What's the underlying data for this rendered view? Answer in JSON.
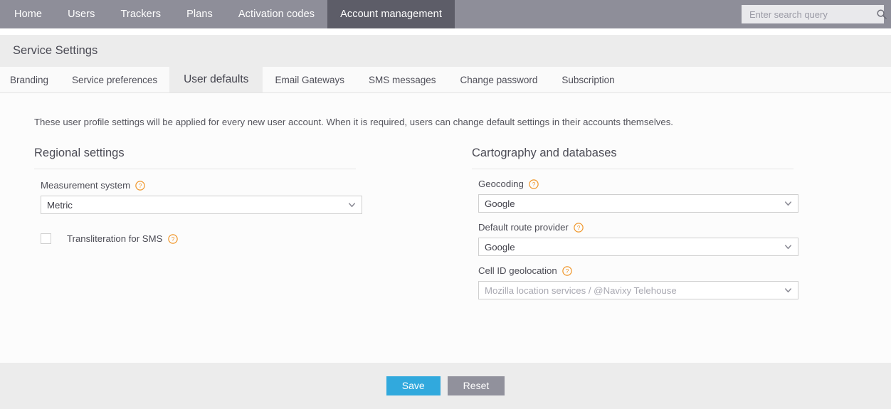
{
  "topnav": {
    "items": [
      {
        "label": "Home",
        "active": false
      },
      {
        "label": "Users",
        "active": false
      },
      {
        "label": "Trackers",
        "active": false
      },
      {
        "label": "Plans",
        "active": false
      },
      {
        "label": "Activation codes",
        "active": false
      },
      {
        "label": "Account management",
        "active": true
      }
    ],
    "search": {
      "placeholder": "Enter search query",
      "value": "",
      "icon": "search-icon"
    }
  },
  "header": {
    "title": "Service Settings"
  },
  "tabs": [
    {
      "label": "Branding",
      "active": false
    },
    {
      "label": "Service preferences",
      "active": false
    },
    {
      "label": "User defaults",
      "active": true
    },
    {
      "label": "Email Gateways",
      "active": false
    },
    {
      "label": "SMS messages",
      "active": false
    },
    {
      "label": "Change password",
      "active": false
    },
    {
      "label": "Subscription",
      "active": false
    }
  ],
  "main": {
    "intro": "These user profile settings will be applied for every new user account. When it is required, users can change default settings in their accounts themselves.",
    "regional": {
      "heading": "Regional settings",
      "measurement_system": {
        "label": "Measurement system",
        "value": "Metric",
        "help_icon": "help-icon",
        "chevron": "chevron-down-icon"
      },
      "transliteration": {
        "label": "Transliteration for SMS",
        "checked": false,
        "help_icon": "help-icon"
      }
    },
    "cartography": {
      "heading": "Cartography and databases",
      "geocoding": {
        "label": "Geocoding",
        "value": "Google",
        "help_icon": "help-icon",
        "chevron": "chevron-down-icon"
      },
      "route_provider": {
        "label": "Default route provider",
        "value": "Google",
        "help_icon": "help-icon",
        "chevron": "chevron-down-icon"
      },
      "cell_id_geolocation": {
        "label": "Cell ID geolocation",
        "value": "Mozilla location services / @Navixy Telehouse",
        "disabled": true,
        "help_icon": "help-icon",
        "chevron": "chevron-down-icon"
      }
    }
  },
  "footer": {
    "save_label": "Save",
    "reset_label": "Reset"
  },
  "colors": {
    "nav_bar": "#8e8e99",
    "nav_active": "#5d5d68",
    "band": "#ececec",
    "tabstrip": "#fafafa",
    "content": "#fcfcfc",
    "save_button": "#31a9dd",
    "reset_button": "#91919c",
    "help_icon": "#f0982d"
  }
}
